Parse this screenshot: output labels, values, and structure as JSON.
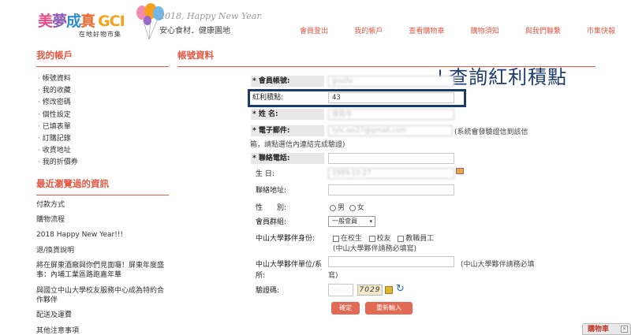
{
  "header": {
    "logo_chars": [
      "美",
      "夢",
      "成",
      "真"
    ],
    "logo_gci": "GCI",
    "logo_sub": "在地好物市集",
    "tagline_en": "2018, Happy New Year.",
    "tagline_cn": "安心食材．健康園地",
    "nav": [
      "會員登出",
      "我的帳戶",
      "查看購物車",
      "購物須知",
      "與我們聯繫",
      "市集快報"
    ]
  },
  "sidebar": {
    "title": "我的帳戶",
    "items": [
      "帳號資料",
      "我的收藏",
      "修改密碼",
      "個性設定",
      "已填表單",
      "訂購記錄",
      "收貨地址",
      "我的折價券"
    ],
    "recent_title": "最近瀏覽過的資訊",
    "recent": [
      "付款方式",
      "購物流程",
      "2018 Happy New Year!!!",
      "退/換貨說明",
      "將在屏東酒廠與你們見面囉！屏東年度盛事：內埔工業區路跑嘉年華",
      "與國立中山大學校友服務中心成為特約合作夥伴",
      "配送及運費",
      "其他注意事項"
    ]
  },
  "main": {
    "title": "帳號資料",
    "annotation": "↓查詢紅利積點",
    "form": {
      "account_label": "* 會員帳號:",
      "account_value": "guuilu",
      "points_label": "紅利積點:",
      "points_value": "43",
      "name_label": "* 姓 名:",
      "name_value": "徐佑令",
      "email_label": "* 電子郵件:",
      "email_value": "tyic.sei27@gmail.com",
      "email_note_1": "(系統會發驗證信到該信",
      "email_note_2": "箱，請點選信內連結完成驗證)",
      "phone_label": "* 聯絡電話:",
      "birthday_label": "生 日:",
      "birthday_value": "1989-10-27",
      "address_label": "聯絡地址:",
      "gender_label": "性　　別:",
      "gender_options": [
        "男",
        "女"
      ],
      "group_label": "會員群組:",
      "group_value": "一般會員",
      "partner_label": "中山大學夥伴身份:",
      "partner_options": [
        "在校生",
        "校友",
        "教職員工"
      ],
      "partner_note": "(中山大學夥伴請務必填寫)",
      "unit_label_1": "中山大學夥伴單位/系",
      "unit_label_2": "所:",
      "unit_note_1": "(中山大學夥伴請務必填",
      "unit_note_2": "寫)",
      "captcha_label": "驗證碼:",
      "captcha_text": "7029",
      "confirm_label": "確定",
      "reset_label": "重新輸入"
    }
  },
  "cart_tab": {
    "label": "購物車",
    "close": "×"
  },
  "colors": {
    "accent": "#e05a45",
    "highlight_box": "#1c3a6e",
    "button": "#e26a55"
  }
}
